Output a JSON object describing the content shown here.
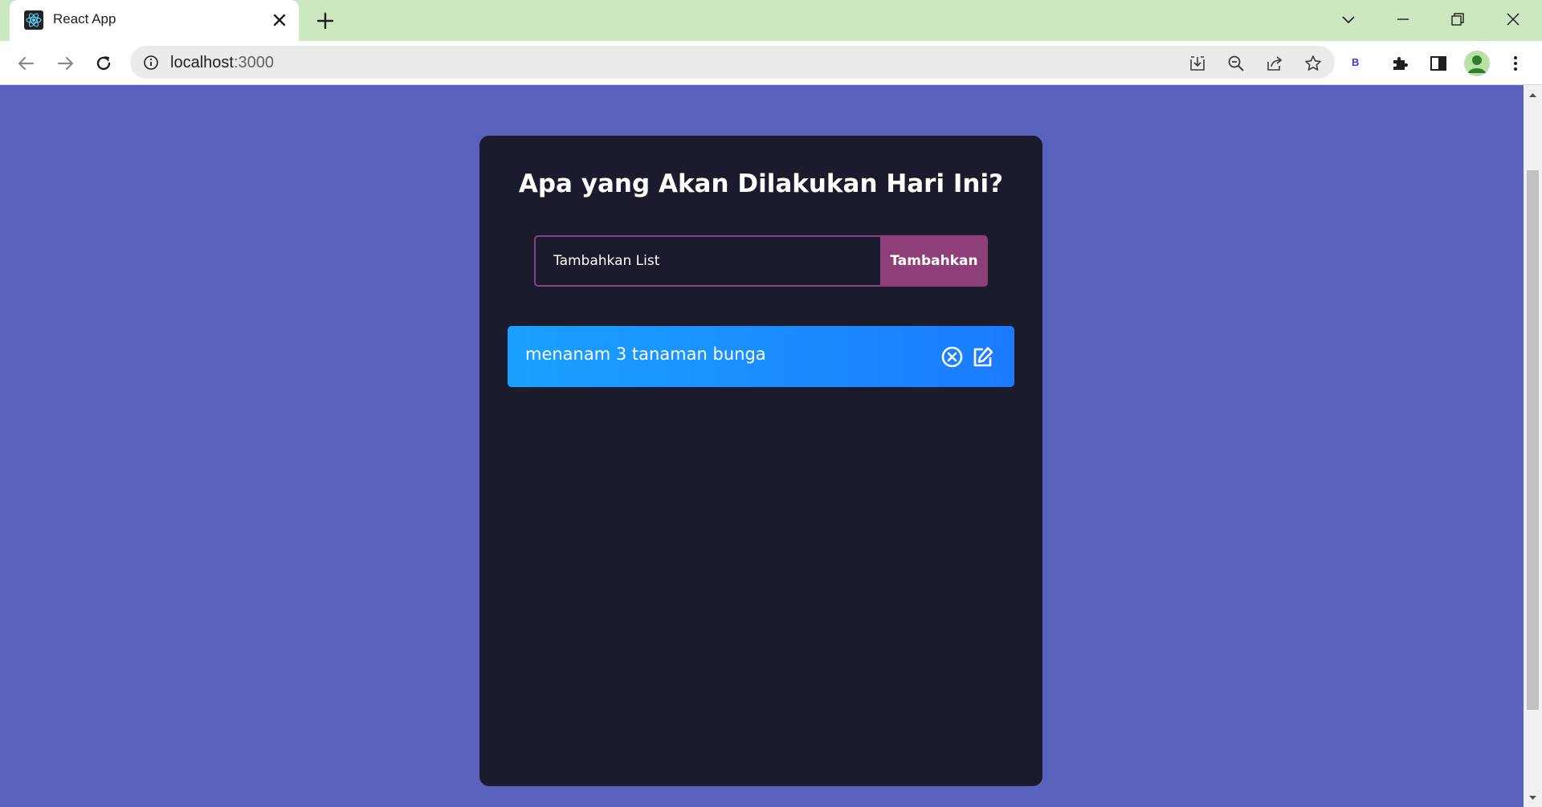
{
  "browser": {
    "tab_title": "React App",
    "url_host": "localhost",
    "url_port": ":3000",
    "extension_label": "B"
  },
  "app": {
    "heading": "Apa yang Akan Dilakukan Hari Ini?",
    "input_placeholder": "Tambahkan List",
    "add_button_label": "Tambahkan",
    "todos": [
      {
        "text": "menanam 3 tanaman bunga"
      }
    ]
  },
  "colors": {
    "page_background": "#5861bb",
    "card_background": "#1a1b2c",
    "accent": "#8e3f78",
    "item_gradient_start": "#1aa1ff",
    "item_gradient_end": "#1b7bff",
    "tabbar_background": "#cce8c0"
  },
  "icons": {
    "tab_favicon": "react-logo-icon",
    "delete_item": "close-circle-icon",
    "edit_item": "edit-icon"
  }
}
